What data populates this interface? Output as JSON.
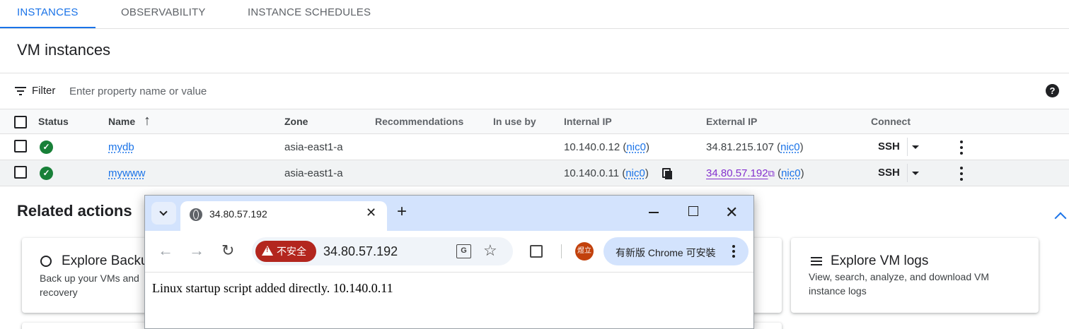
{
  "tabs": [
    {
      "label": "INSTANCES",
      "active": true
    },
    {
      "label": "OBSERVABILITY",
      "active": false
    },
    {
      "label": "INSTANCE SCHEDULES",
      "active": false
    }
  ],
  "page_title": "VM instances",
  "filter": {
    "label": "Filter",
    "placeholder": "Enter property name or value",
    "help_icon": "?"
  },
  "table": {
    "columns": [
      "Status",
      "Name",
      "Zone",
      "Recommendations",
      "In use by",
      "Internal IP",
      "External IP",
      "Connect"
    ],
    "sort_indicator": "↑",
    "rows": [
      {
        "status": "✓",
        "name": "mydb",
        "zone": "asia-east1-a",
        "internal_ip": "10.140.0.12",
        "internal_nic": "nic0",
        "external_ip": "34.81.215.107",
        "external_nic": "nic0",
        "connect": "SSH"
      },
      {
        "status": "✓",
        "name": "mywww",
        "zone": "asia-east1-a",
        "internal_ip": "10.140.0.11",
        "internal_nic": "nic0",
        "external_ip": "34.80.57.192",
        "external_nic": "nic0",
        "connect": "SSH"
      }
    ],
    "paren_open": "(",
    "paren_close": ")"
  },
  "related": {
    "title": "Related actions",
    "cards": [
      {
        "title": "Explore Backu",
        "desc_line1": "Back up your VMs and",
        "desc_line2": "recovery"
      },
      {
        "title": "Explore VM logs",
        "desc_line1": "View, search, analyze, and download VM",
        "desc_line2": "instance logs"
      }
    ]
  },
  "browser": {
    "tab_title": "34.80.57.192",
    "tab_close": "✕",
    "new_tab": "+",
    "close_window": "✕",
    "back": "←",
    "forward": "→",
    "reload": "↻",
    "insecure_label": "不安全",
    "url": "34.80.57.192",
    "translate_glyph": "G",
    "star": "☆",
    "profile_initials": "煜立",
    "update_text": "有新版 Chrome 可安裝",
    "page_text": "Linux startup script added directly. 10.140.0.11"
  },
  "colors": {
    "accent": "#1a73e8",
    "status_ok": "#188038",
    "visited_link": "#8430ce",
    "insecure_badge": "#b3261e",
    "chrome_frame": "#d3e3fd"
  }
}
